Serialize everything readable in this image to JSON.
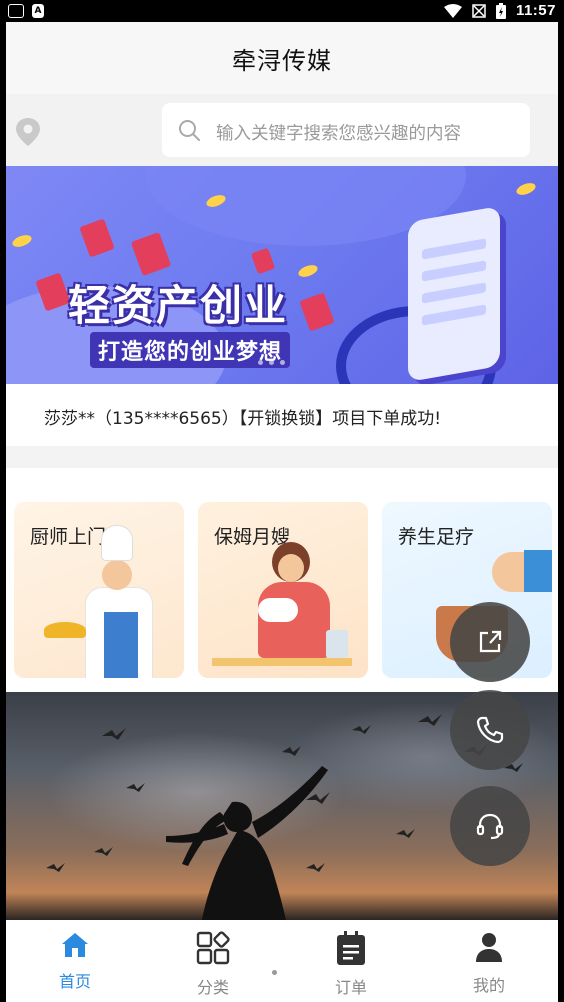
{
  "status_bar": {
    "time": "11:57"
  },
  "header": {
    "title": "牵浔传媒"
  },
  "search": {
    "placeholder": "输入关键字搜索您感兴趣的内容"
  },
  "banner": {
    "title": "轻资产创业",
    "subtitle": "打造您的创业梦想"
  },
  "notice": {
    "text": "莎莎**（135****6565）【开锁换锁】项目下单成功!"
  },
  "services": [
    {
      "label": "厨师上门"
    },
    {
      "label": "保姆月嫂"
    },
    {
      "label": "养生足疗"
    }
  ],
  "bottom_nav": [
    {
      "label": "首页",
      "icon": "home-icon",
      "active": true
    },
    {
      "label": "分类",
      "icon": "category-icon",
      "active": false
    },
    {
      "label": "订单",
      "icon": "order-icon",
      "active": false
    },
    {
      "label": "我的",
      "icon": "user-icon",
      "active": false
    }
  ],
  "floating_buttons": [
    "share-icon",
    "phone-icon",
    "headset-icon"
  ],
  "colors": {
    "accent": "#2b8ae0",
    "fab": "#464646"
  }
}
